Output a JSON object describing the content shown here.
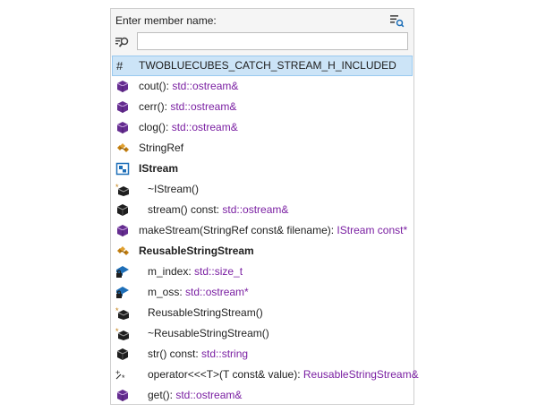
{
  "header": {
    "title": "Enter member name:"
  },
  "search": {
    "value": "",
    "placeholder": ""
  },
  "items": [
    {
      "name": "TWOBLUECUBES_CATCH_STREAM_H_INCLUDED",
      "type": "",
      "icon": "macro-icon"
    },
    {
      "name": "cout(): ",
      "type": "std::ostream&",
      "icon": "function-icon"
    },
    {
      "name": "cerr(): ",
      "type": "std::ostream&",
      "icon": "function-icon"
    },
    {
      "name": "clog(): ",
      "type": "std::ostream&",
      "icon": "function-icon"
    },
    {
      "name": "StringRef",
      "type": "",
      "icon": "class-icon"
    },
    {
      "name": "IStream",
      "type": "",
      "icon": "interface-icon"
    },
    {
      "name": "~IStream()",
      "type": "",
      "icon": "destructor-icon"
    },
    {
      "name": "stream() const: ",
      "type": "std::ostream&",
      "icon": "method-icon"
    },
    {
      "name": "makeStream(StringRef const& filename): ",
      "type": "IStream const*",
      "icon": "function-icon"
    },
    {
      "name": "ReusableStringStream",
      "type": "",
      "icon": "class-icon"
    },
    {
      "name": "m_index: ",
      "type": "std::size_t",
      "icon": "private-field-icon"
    },
    {
      "name": "m_oss: ",
      "type": "std::ostream*",
      "icon": "private-field-icon"
    },
    {
      "name": "ReusableStringStream()",
      "type": "",
      "icon": "constructor-icon"
    },
    {
      "name": "~ReusableStringStream()",
      "type": "",
      "icon": "destructor-icon"
    },
    {
      "name": "str() const: ",
      "type": "std::string",
      "icon": "method-icon"
    },
    {
      "name": "operator<<<T>(T const& value): ",
      "type": "ReusableStringStream&",
      "icon": "operator-icon"
    },
    {
      "name": "get(): ",
      "type": "std::ostream&",
      "icon": "method-icon"
    }
  ],
  "colors": {
    "accent_purple": "#652d90",
    "type_text": "#7a1fa2",
    "class_orange": "#c27d0e",
    "interface_blue": "#1e6fb8",
    "selection": "#cce4f7"
  }
}
